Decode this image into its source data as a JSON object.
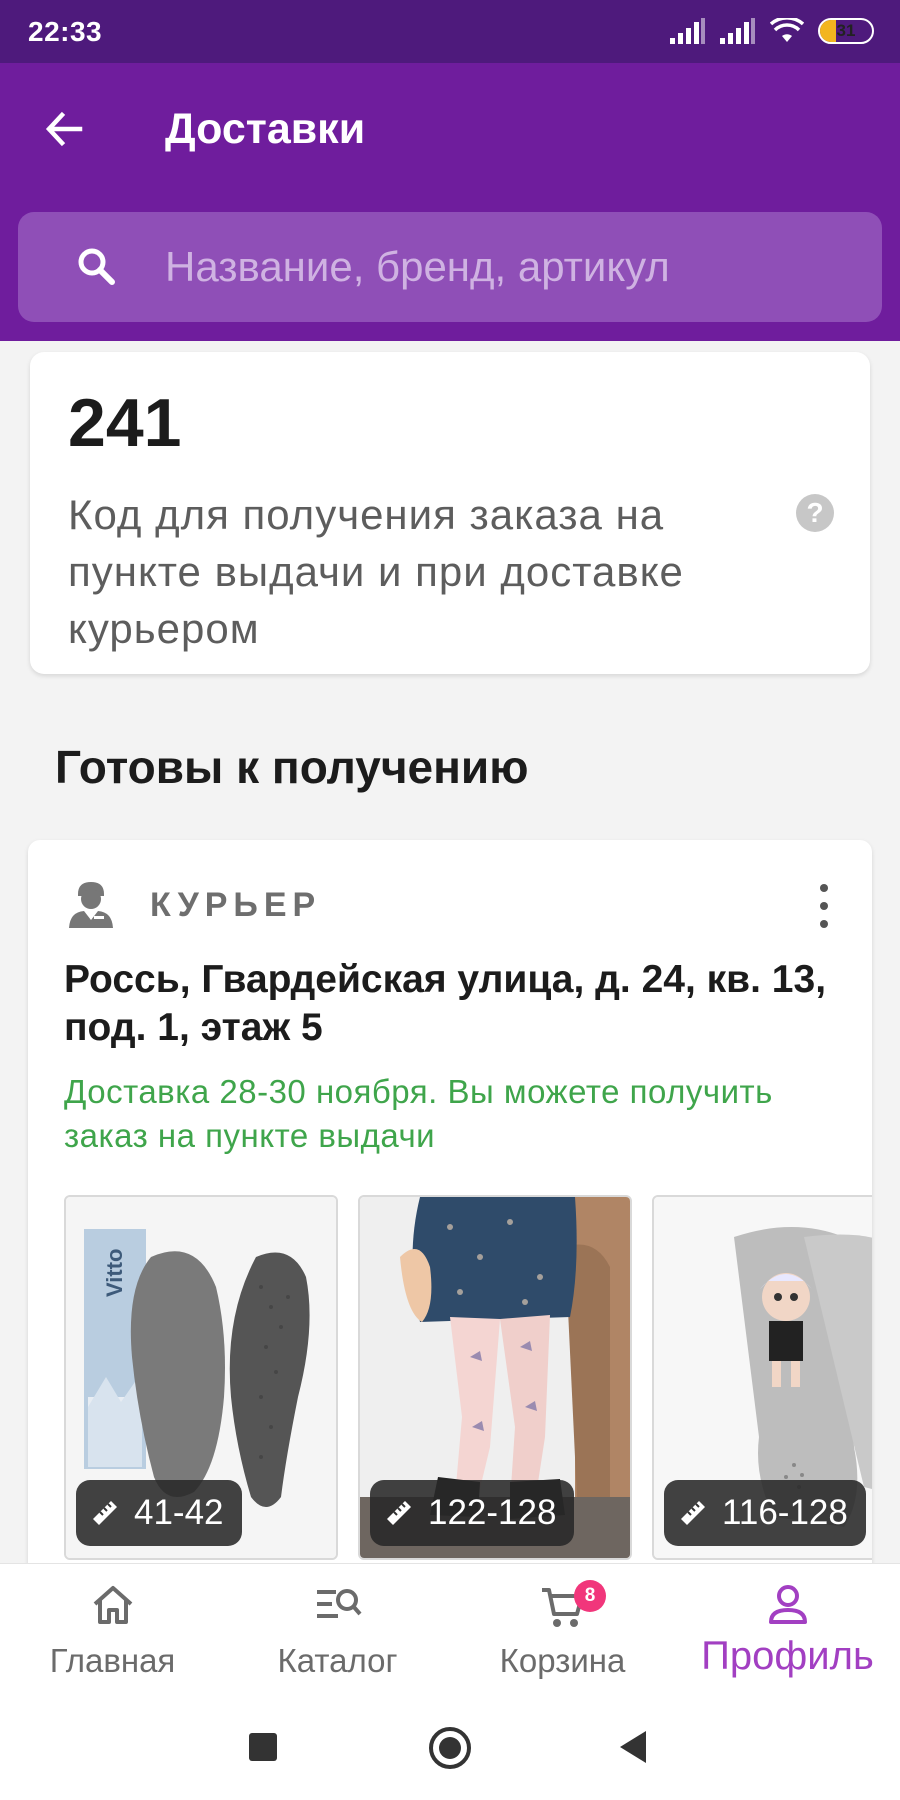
{
  "status_bar": {
    "time": "22:33",
    "battery": "31",
    "battery_fraction": 0.31
  },
  "app_bar": {
    "title": "Доставки",
    "back_icon": "arrow-left-icon"
  },
  "search": {
    "placeholder": "Название, бренд, артикул",
    "icon": "search-icon"
  },
  "code_card": {
    "code": "241",
    "description": "Код для получения заказа на пункте выдачи и при доставке курьером",
    "help_icon": "help-icon"
  },
  "section": {
    "title": "Готовы к получению"
  },
  "delivery": {
    "type_label": "КУРЬЕР",
    "address": "Россь, Гвардейская улица, д. 24, кв. 13, под. 1, этаж 5",
    "info": "Доставка 28-30 ноября. Вы можете получить заказ на пункте выдачи",
    "info_color": "#3fa54b",
    "products": [
      {
        "size": "41-42",
        "image": "insoles-image"
      },
      {
        "size": "122-128",
        "image": "tights-pink-image"
      },
      {
        "size": "116-128",
        "image": "tights-grey-image"
      }
    ]
  },
  "bottom_nav": {
    "items": [
      {
        "label": "Главная",
        "icon": "home-icon"
      },
      {
        "label": "Каталог",
        "icon": "catalog-icon"
      },
      {
        "label": "Корзина",
        "icon": "cart-icon",
        "badge": "8"
      },
      {
        "label": "Профиль",
        "icon": "profile-icon",
        "active": true
      }
    ]
  },
  "colors": {
    "primary": "#6f1d9d",
    "status_bar": "#4e1a7c",
    "accent": "#a23fc2",
    "badge": "#f1367b"
  }
}
